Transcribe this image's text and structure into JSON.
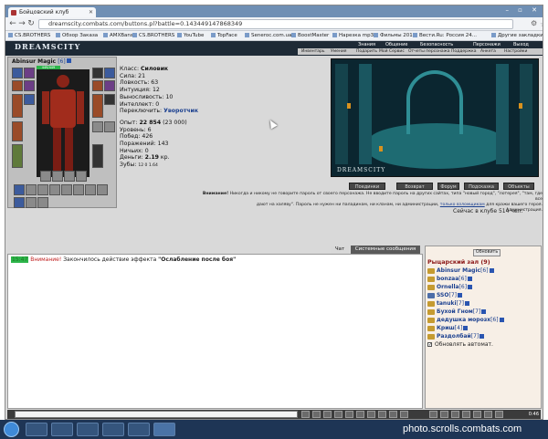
{
  "browser": {
    "tab_title": "Бойцовский клуб",
    "url": "dreamscity.combats.com/buttons.pl?battle=0.143449147868349",
    "bookmarks": [
      "CS.BROTHERS",
      "Обзор Заказа",
      "AMXBans",
      "CS.BROTHERS",
      "YouTube",
      "TopFace",
      "Seneroc.com.ua",
      "BoostMaster",
      "Нарезка mp3",
      "Фильмы 2014",
      "Вести.Ru: Россия 24...",
      "Другие закладки"
    ]
  },
  "game": {
    "logo": "DREAMSCITY",
    "top_menu": [
      "Знания",
      "Общение",
      "Безопасность",
      "Персонажи",
      "Выход"
    ],
    "sub_menu": [
      "Инвентарь",
      "Умения",
      "Подарить",
      "Мой Сервис",
      "Отчеты персонажа",
      "Поддержка",
      "Анкета",
      "Настройки"
    ]
  },
  "character": {
    "name": "Abinsur Magic",
    "level": "[6]",
    "hp": "449/449",
    "class_label": "Класс:",
    "class_value": "Силовик",
    "stats": [
      "Сила: 21",
      "Ловкость: 63",
      "Интуиция: 12",
      "Выносливость: 10",
      "Интеллект: 0"
    ],
    "switch_label": "Переключить:",
    "switch_value": "Уворотчик",
    "exp_label": "Опыт:",
    "exp_value": "22 854",
    "exp_next": "(23 000)",
    "level_line": "Уровень: 6",
    "wins": "Побед: 426",
    "losses": "Поражений: 143",
    "draws": "Ничьих: 0",
    "money_label": "Деньги:",
    "money_value": "2.19",
    "money_unit": "кр.",
    "teeth_label": "Зубы:",
    "teeth_value": "12 0 1.64"
  },
  "scene": {
    "label": "DREAMSCITY"
  },
  "actions": [
    "Поединки",
    "Возврат",
    "Форум",
    "Подсказка",
    "Объекты"
  ],
  "warning": {
    "prefix": "Внимание!",
    "line1": "Никогда и никому не говорите пароль от своего персонажа. Не вводите пароль на других сайтах, типа \"новый город\", \"лотерея\", \"там, где все",
    "line2": "дают на халяву\". Пароль не нужен ни паладинам, ни кланам, ни администрации,",
    "link": "только взломщикам",
    "line2_end": "для кражи вашего героя.",
    "signature": "Администрация."
  },
  "online": "Сейчас в клубе 514 чел.",
  "chat": {
    "tabs": [
      "Чат",
      "Системные сообщения"
    ],
    "time": "15:47",
    "warn": "Внимание!",
    "message": "Закончилось действие эффекта",
    "effect": "\"Ослабление после боя\""
  },
  "room": {
    "refresh": "Обновить",
    "title": "Рыцарский зал (9)",
    "players": [
      {
        "name": "Abinsur Magic",
        "level": "[6]"
      },
      {
        "name": "bonzaa",
        "level": "[6]"
      },
      {
        "name": "Ornella",
        "level": "[6]"
      },
      {
        "name": "SSO",
        "level": "[7]"
      },
      {
        "name": "tanuki",
        "level": "[7]"
      },
      {
        "name": "Бухой Гном",
        "level": "[7]"
      },
      {
        "name": "дедушка морозх",
        "level": "[6]"
      },
      {
        "name": "Криш",
        "level": "[4]"
      },
      {
        "name": "Раздолбай",
        "level": "[7]"
      }
    ],
    "auto": "Обновлять автомат."
  },
  "gamebar": {
    "time": "0:46"
  },
  "watermark": "photo.scrolls.combats.com"
}
